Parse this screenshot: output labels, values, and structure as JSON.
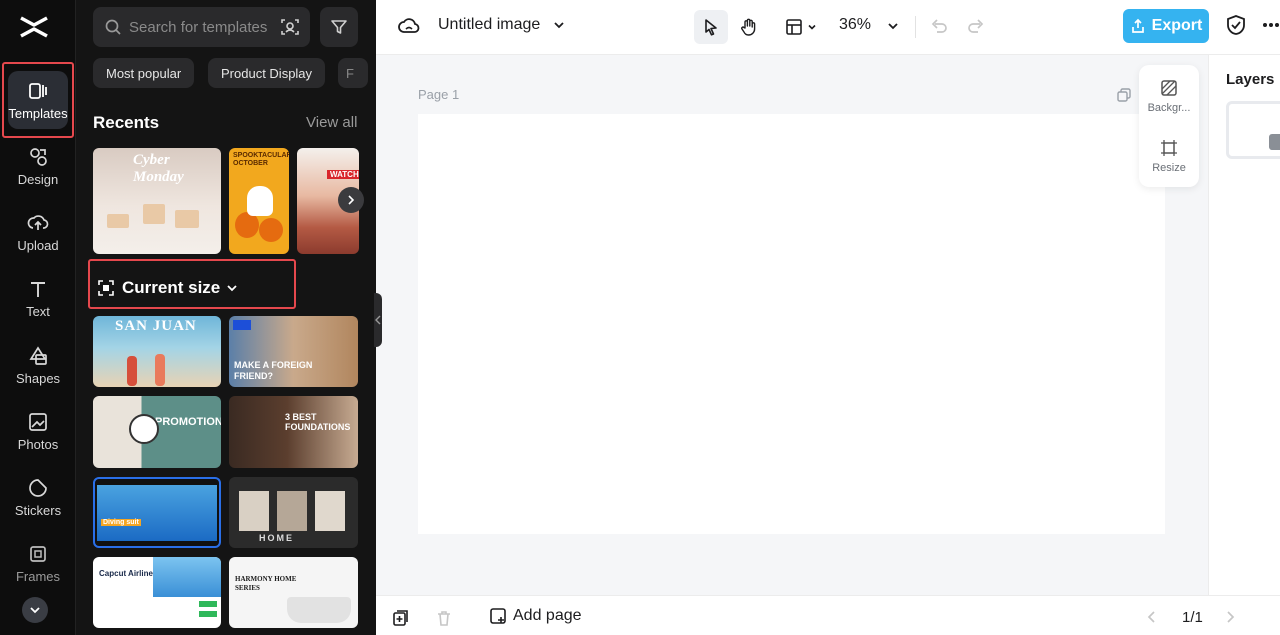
{
  "nav": {
    "items": [
      {
        "label": "Templates",
        "icon": "templates-icon",
        "active": true
      },
      {
        "label": "Design",
        "icon": "design-icon"
      },
      {
        "label": "Upload",
        "icon": "upload-icon"
      },
      {
        "label": "Text",
        "icon": "text-icon"
      },
      {
        "label": "Shapes",
        "icon": "shapes-icon"
      },
      {
        "label": "Photos",
        "icon": "photos-icon"
      },
      {
        "label": "Stickers",
        "icon": "stickers-icon"
      },
      {
        "label": "Frames",
        "icon": "frames-icon"
      }
    ]
  },
  "panel": {
    "search_placeholder": "Search for templates",
    "chips": [
      "Most popular",
      "Product Display",
      "F"
    ],
    "recents_title": "Recents",
    "view_all": "View all",
    "current_size": "Current size",
    "recent_thumbs": [
      {
        "caption": "Cyber Monday"
      },
      {
        "caption": "SPOOKTACULAR OCTOBER"
      },
      {
        "caption": "WATCH"
      }
    ],
    "template_thumbs": [
      {
        "caption": "SAN JUAN"
      },
      {
        "caption": "MAKE A FOREIGN FRIEND?"
      },
      {
        "caption": "PROMOTION"
      },
      {
        "caption": "3 BEST FOUNDATIONS"
      },
      {
        "caption": "Diving suit"
      },
      {
        "caption": "HOME"
      },
      {
        "caption": "Capcut Airline"
      },
      {
        "caption": "HARMONY HOME SERIES"
      }
    ]
  },
  "topbar": {
    "title": "Untitled image",
    "zoom": "36%",
    "export_label": "Export"
  },
  "canvas": {
    "page_label": "Page 1"
  },
  "floater": {
    "background_label": "Backgr...",
    "resize_label": "Resize"
  },
  "layers": {
    "title": "Layers"
  },
  "bottombar": {
    "add_page": "Add page",
    "pager": "1/1"
  },
  "colors": {
    "accent": "#35b3f0",
    "highlight": "#e5484d",
    "panel_bg": "#141414"
  }
}
